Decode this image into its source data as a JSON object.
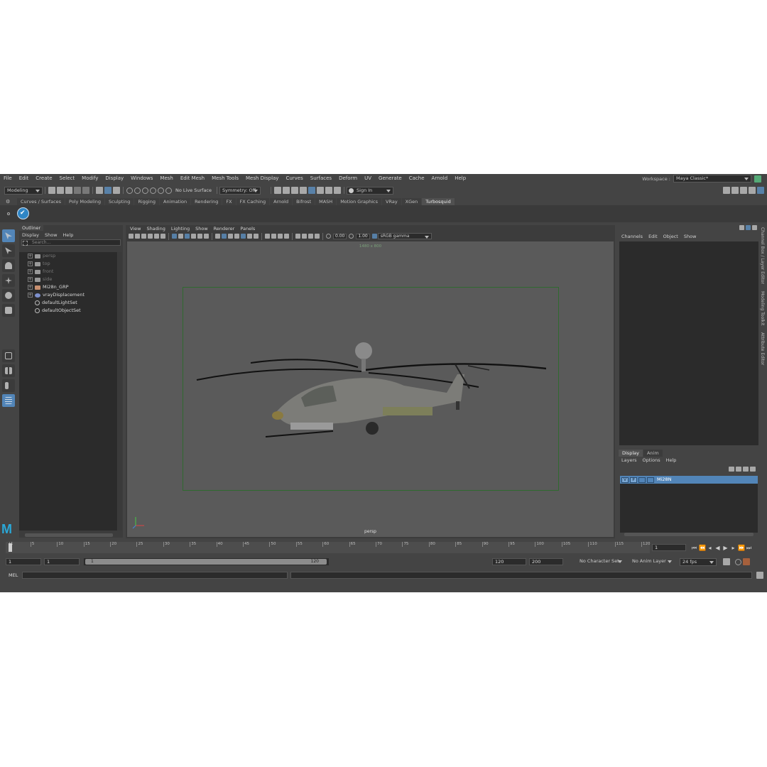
{
  "menubar": {
    "items": [
      "File",
      "Edit",
      "Create",
      "Select",
      "Modify",
      "Display",
      "Windows",
      "Mesh",
      "Edit Mesh",
      "Mesh Tools",
      "Mesh Display",
      "Curves",
      "Surfaces",
      "Deform",
      "UV",
      "Generate",
      "Cache",
      "Arnold",
      "Help"
    ],
    "workspace_label": "Workspace :",
    "workspace_value": "Maya Classic*"
  },
  "statusline": {
    "mode": "Modeling",
    "live_surface": "No Live Surface",
    "symmetry": "Symmetry: Off",
    "sign_in": "Sign In"
  },
  "shelf": {
    "tabs": [
      "Curves / Surfaces",
      "Poly Modeling",
      "Sculpting",
      "Rigging",
      "Animation",
      "Rendering",
      "FX",
      "FX Caching",
      "Arnold",
      "Bifrost",
      "MASH",
      "Motion Graphics",
      "VRay",
      "XGen",
      "Turbosquid"
    ],
    "active_tab": "Turbosquid"
  },
  "outliner": {
    "title": "Outliner",
    "menu": [
      "Display",
      "Show",
      "Help"
    ],
    "search_placeholder": "Search...",
    "items": [
      {
        "label": "persp",
        "dim": true,
        "icon": "camera-icon"
      },
      {
        "label": "top",
        "dim": true,
        "icon": "camera-icon"
      },
      {
        "label": "front",
        "dim": true,
        "icon": "camera-icon"
      },
      {
        "label": "side",
        "dim": true,
        "icon": "camera-icon"
      },
      {
        "label": "Mi28n_GRP",
        "dim": false,
        "icon": "group-icon"
      },
      {
        "label": "vrayDisplacement",
        "dim": false,
        "icon": "displacement-icon"
      },
      {
        "label": "defaultLightSet",
        "dim": false,
        "icon": "set-icon"
      },
      {
        "label": "defaultObjectSet",
        "dim": false,
        "icon": "set-icon"
      }
    ]
  },
  "viewport": {
    "menu": [
      "View",
      "Shading",
      "Lighting",
      "Show",
      "Renderer",
      "Panels"
    ],
    "exposure": "0.00",
    "gamma": "1.00",
    "color_space": "sRGB gamma",
    "resolution_label": "1480 x 800",
    "camera": "persp"
  },
  "channelbox": {
    "menu": [
      "Channels",
      "Edit",
      "Object",
      "Show"
    ],
    "side_tabs": [
      "Channel Box / Layer Editor",
      "Modeling Toolkit",
      "Attribute Editor"
    ]
  },
  "layereditor": {
    "tabs": [
      "Display",
      "Anim"
    ],
    "active_tab": "Display",
    "menu": [
      "Layers",
      "Options",
      "Help"
    ],
    "layer": {
      "v": "V",
      "p": "P",
      "name": "Mi28N"
    }
  },
  "timeslider": {
    "ticks": [
      "1",
      "5",
      "10",
      "15",
      "20",
      "25",
      "30",
      "35",
      "40",
      "45",
      "50",
      "55",
      "60",
      "65",
      "70",
      "75",
      "80",
      "85",
      "90",
      "95",
      "100",
      "105",
      "110",
      "115",
      "120"
    ],
    "current_frame": "1"
  },
  "rangeslider": {
    "start": "1",
    "anim_start": "1",
    "range_start": "1",
    "range_end": "120",
    "playback_end": "120",
    "anim_end": "200",
    "character_set": "No Character Set",
    "anim_layer": "No Anim Layer",
    "fps": "24 fps"
  },
  "cmdline": {
    "label": "MEL"
  }
}
